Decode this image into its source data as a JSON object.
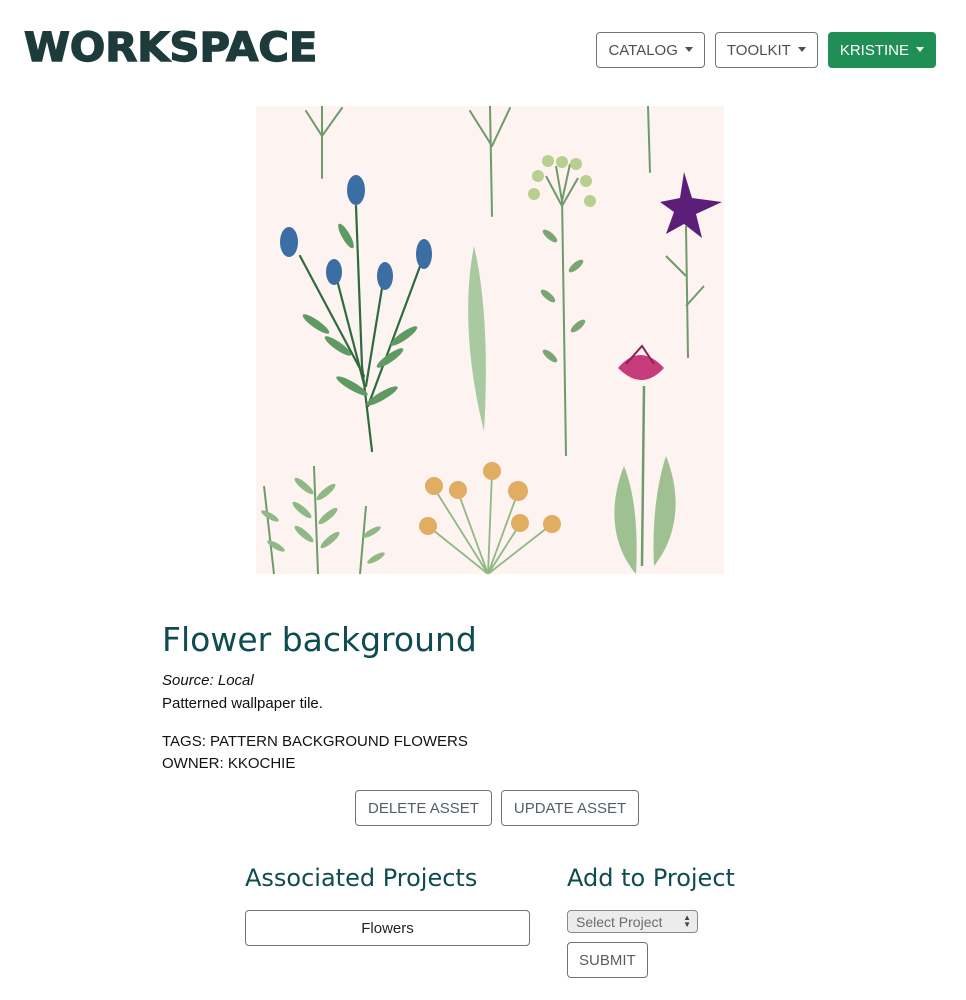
{
  "header": {
    "brand": "WORKSPACE",
    "nav": [
      {
        "label": "CATALOG"
      },
      {
        "label": "TOOLKIT"
      },
      {
        "label": "KRISTINE"
      }
    ]
  },
  "asset": {
    "image_alt": "Watercolor wildflower pattern",
    "title": "Flower background",
    "source": "Source: Local",
    "description": "Patterned wallpaper tile.",
    "tags": "TAGS: PATTERN BACKGROUND FLOWERS",
    "owner": "OWNER: KKOCHIE",
    "delete_label": "DELETE ASSET",
    "update_label": "UPDATE ASSET"
  },
  "associated": {
    "heading": "Associated Projects",
    "projects": [
      "Flowers"
    ]
  },
  "add_to_project": {
    "heading": "Add to Project",
    "select_value": "Select Project",
    "submit_label": "SUBMIT"
  },
  "colors": {
    "brand": "#1d3b3a",
    "heading": "#0f4c52",
    "primary": "#1f8f55",
    "image_bg": "#fdf3f1"
  }
}
